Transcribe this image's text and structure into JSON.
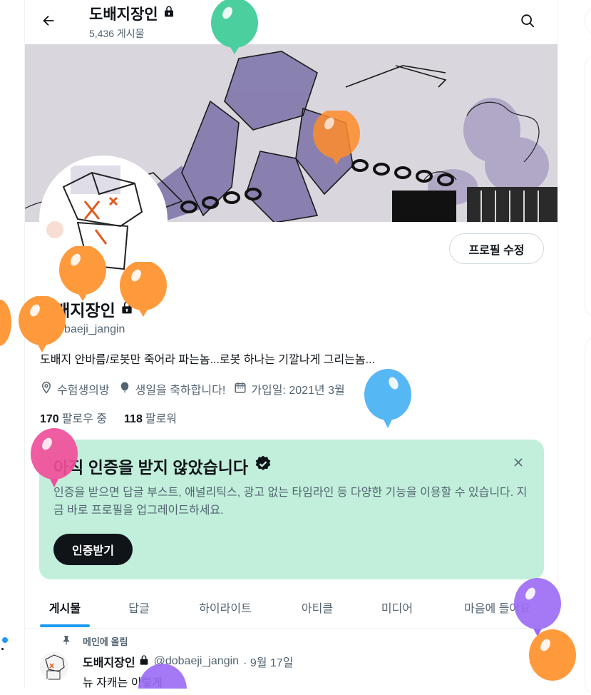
{
  "header": {
    "title": "도배지장인",
    "post_count": "5,436 게시물"
  },
  "profile": {
    "edit_button": "프로필 수정",
    "name": "도배지장인",
    "handle": "@dobaeji_jangin",
    "bio": "도배지 안바름/로봇만 죽어라 파는놈...로봇 하나는 기깔나게 그리는놈...",
    "location": "수험생의방",
    "birthday": "생일을 축하합니다!",
    "joined": "가입일: 2021년 3월",
    "following_count": "170",
    "following_label": "팔로우 중",
    "followers_count": "118",
    "followers_label": "팔로워"
  },
  "verify_card": {
    "title": "아직 인증을 받지 않았습니다",
    "description": "인증을 받으면 답글 부스트, 애널리틱스, 광고 없는 타임라인 등 다양한 기능을 이용할 수 있습니다. 지금 바로 프로필을 업그레이드하세요.",
    "button": "인증받기"
  },
  "tabs": [
    {
      "label": "게시물"
    },
    {
      "label": "답글"
    },
    {
      "label": "하이라이트"
    },
    {
      "label": "아티클"
    },
    {
      "label": "미디어"
    },
    {
      "label": "마음에 들어요"
    }
  ],
  "pinned_post": {
    "pinned_label": "메인에 올림",
    "author_name": "도배지장인",
    "author_handle": "@dobaeji_jangin",
    "date": "· 9월 17일",
    "text": "뉴 자캐는 이렇게",
    "more": "···"
  },
  "colors": {
    "accent": "#1d9bf0",
    "verify_bg": "#c1efdb",
    "text_primary": "#0f1419",
    "text_secondary": "#536471"
  }
}
